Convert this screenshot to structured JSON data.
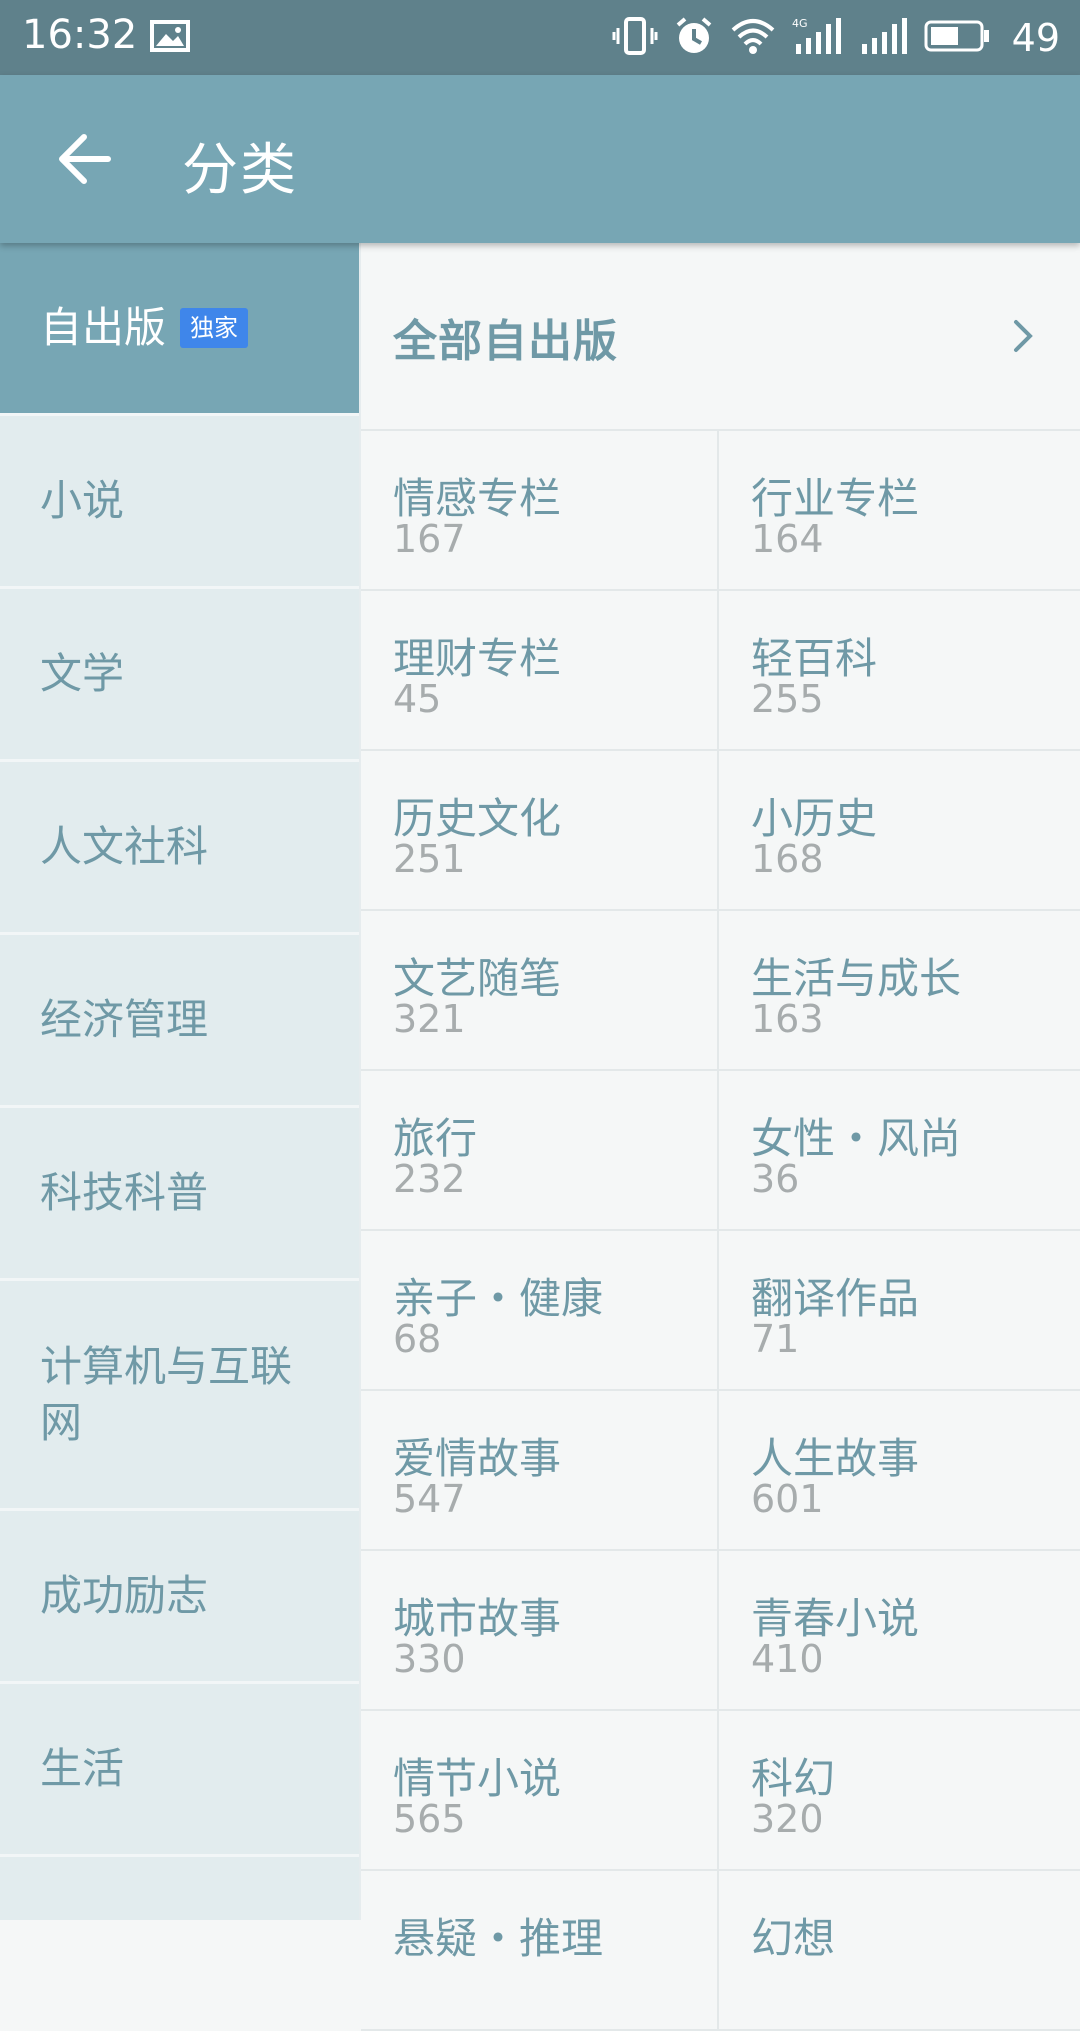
{
  "status_bar": {
    "time": "16:32",
    "battery_level": "49",
    "icons": [
      "image-icon",
      "vibrate-icon",
      "alarm-icon",
      "wifi-icon",
      "signal-4g-icon",
      "signal-icon",
      "battery-icon"
    ]
  },
  "app_bar": {
    "title": "分类",
    "back_icon": "arrow-left-icon"
  },
  "sidebar": {
    "items": [
      {
        "label": "自出版",
        "badge": "独家",
        "active": true
      },
      {
        "label": "小说"
      },
      {
        "label": "文学"
      },
      {
        "label": "人文社科"
      },
      {
        "label": "经济管理"
      },
      {
        "label": "科技科普"
      },
      {
        "label": "计算机与互联网"
      },
      {
        "label": "成功励志"
      },
      {
        "label": "生活"
      }
    ]
  },
  "main": {
    "header_title": "全部自出版",
    "categories": [
      {
        "name": "情感专栏",
        "count": "167"
      },
      {
        "name": "行业专栏",
        "count": "164"
      },
      {
        "name": "理财专栏",
        "count": "45"
      },
      {
        "name": "轻百科",
        "count": "255"
      },
      {
        "name": "历史文化",
        "count": "251"
      },
      {
        "name": "小历史",
        "count": "168"
      },
      {
        "name": "文艺随笔",
        "count": "321"
      },
      {
        "name": "生活与成长",
        "count": "163"
      },
      {
        "name": "旅行",
        "count": "232"
      },
      {
        "name": "女性・风尚",
        "count": "36"
      },
      {
        "name": "亲子・健康",
        "count": "68"
      },
      {
        "name": "翻译作品",
        "count": "71"
      },
      {
        "name": "爱情故事",
        "count": "547"
      },
      {
        "name": "人生故事",
        "count": "601"
      },
      {
        "name": "城市故事",
        "count": "330"
      },
      {
        "name": "青春小说",
        "count": "410"
      },
      {
        "name": "情节小说",
        "count": "565"
      },
      {
        "name": "科幻",
        "count": "320"
      },
      {
        "name": "悬疑・推理",
        "count": ""
      },
      {
        "name": "幻想",
        "count": ""
      }
    ]
  },
  "colors": {
    "status_bar": "#5f818b",
    "app_bar": "#77a6b4",
    "sidebar_bg": "#e2ecee",
    "accent_text": "#6f99a6",
    "count_text": "#a7acad",
    "badge": "#3f86ea"
  }
}
